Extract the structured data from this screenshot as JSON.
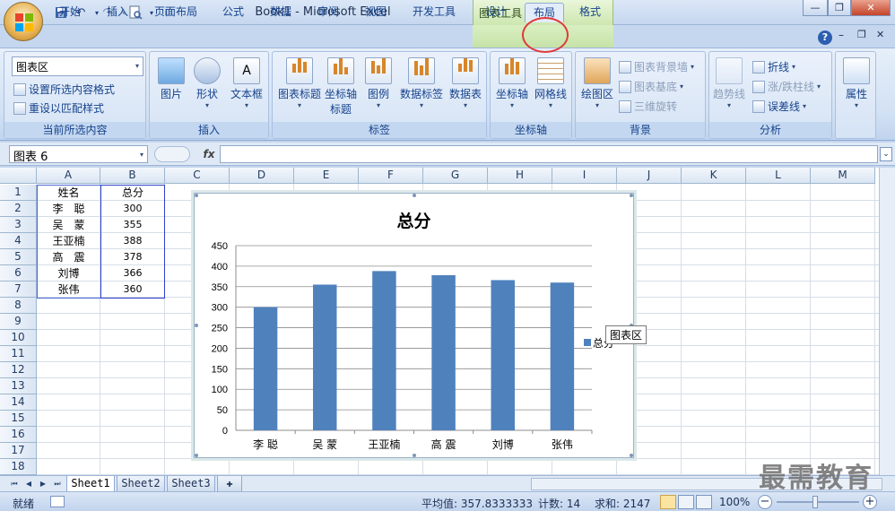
{
  "window": {
    "title": "Book1 - Microsoft Excel",
    "context_tab_group": "图表工具",
    "controls": {
      "minimize": "—",
      "restore": "❐",
      "close": "✕"
    }
  },
  "quick_access": {
    "save_icon": "save-icon",
    "undo_icon": "undo-icon",
    "redo_icon": "redo-icon",
    "print_preview_icon": "print-preview-icon"
  },
  "ribbon_tabs": [
    "开始",
    "插入",
    "页面布局",
    "公式",
    "数据",
    "审阅",
    "视图",
    "开发工具",
    "设计",
    "布局",
    "格式"
  ],
  "active_tab": "布局",
  "ribbon": {
    "current_selection": {
      "combo_value": "图表区",
      "format_selection": "设置所选内容格式",
      "reset_style": "重设以匹配样式",
      "label": "当前所选内容"
    },
    "insert": {
      "picture": "图片",
      "shapes": "形状",
      "textbox": "文本框",
      "label": "插入"
    },
    "labels": {
      "chart_title": "图表标题",
      "axis_titles_line1": "坐标轴",
      "axis_titles_line2": "标题",
      "legend": "图例",
      "data_labels": "数据标签",
      "data_table": "数据表",
      "label": "标签"
    },
    "axes": {
      "axes": "坐标轴",
      "gridlines": "网格线",
      "label": "坐标轴"
    },
    "background": {
      "plot_area": "绘图区",
      "chart_wall": "图表背景墙",
      "chart_floor": "图表基底",
      "rotation_3d": "三维旋转",
      "label": "背景"
    },
    "analysis": {
      "trendline": "趋势线",
      "lines": "折线",
      "updown_bars": "涨/跌柱线",
      "error_bars": "误差线",
      "label": "分析"
    },
    "properties": {
      "label": "属性"
    }
  },
  "formula_bar": {
    "name_box": "图表 6",
    "fx": "fx",
    "value": ""
  },
  "sheet": {
    "columns": [
      "A",
      "B",
      "C",
      "D",
      "E",
      "F",
      "G",
      "H",
      "I",
      "J",
      "K",
      "L",
      "M"
    ],
    "rows": [
      "1",
      "2",
      "3",
      "4",
      "5",
      "6",
      "7",
      "8",
      "9",
      "10",
      "11",
      "12",
      "13",
      "14",
      "15",
      "16",
      "17",
      "18"
    ],
    "header": [
      "姓名",
      "总分"
    ],
    "data": [
      [
        "李　聪",
        "300"
      ],
      [
        "吴　蒙",
        "355"
      ],
      [
        "王亚楠",
        "388"
      ],
      [
        "高　震",
        "378"
      ],
      [
        "刘博",
        "366"
      ],
      [
        "张伟",
        "360"
      ]
    ]
  },
  "chart_data": {
    "type": "bar",
    "title": "总分",
    "categories": [
      "李 聪",
      "吴 蒙",
      "王亚楠",
      "高 震",
      "刘博",
      "张伟"
    ],
    "series": [
      {
        "name": "总分",
        "values": [
          300,
          355,
          388,
          378,
          366,
          360
        ],
        "color": "#4f81bd"
      }
    ],
    "yticks": [
      "0",
      "50",
      "100",
      "150",
      "200",
      "250",
      "300",
      "350",
      "400",
      "450"
    ],
    "ylim": [
      0,
      450
    ],
    "grid": true,
    "legend": "right"
  },
  "tooltip": "图表区",
  "sheet_tabs": [
    "Sheet1",
    "Sheet2",
    "Sheet3"
  ],
  "active_sheet": "Sheet1",
  "status": {
    "mode": "就绪",
    "average": "平均值: 357.8333333",
    "count": "计数: 14",
    "sum": "求和: 2147",
    "zoom": "100%"
  },
  "watermark": "最需教育"
}
